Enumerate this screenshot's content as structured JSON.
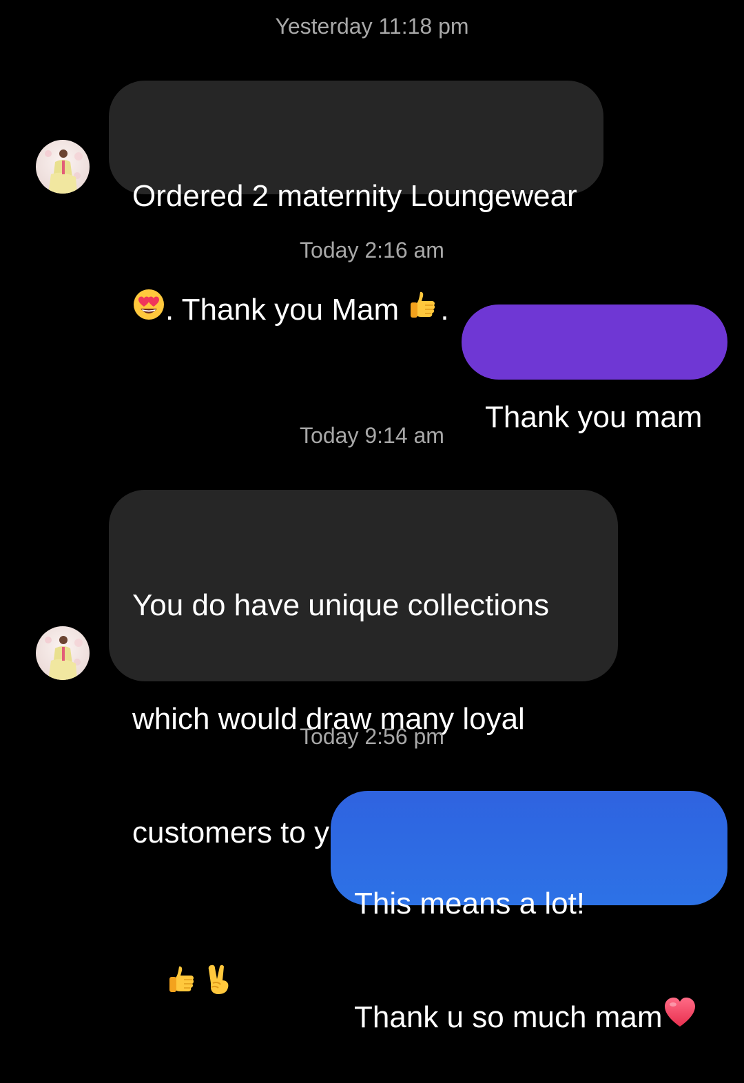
{
  "colors": {
    "background": "#000000",
    "incoming_bubble": "#262626",
    "outgoing_bubble_purple": "#6f37d4",
    "outgoing_bubble_blue_top": "#2f63e0",
    "outgoing_bubble_blue_bottom": "#2d72e6",
    "timestamp_text": "#a8a8a8"
  },
  "thread": [
    {
      "timestamp": "Yesterday 11:18 pm",
      "message": {
        "direction": "incoming",
        "line1": "Ordered 2 maternity Loungewear",
        "line2_text": ". Thank you Mam",
        "line2_end": ".",
        "emojis": [
          "heart-eyes-emoji",
          "thumbs-up-emoji"
        ]
      }
    },
    {
      "timestamp": "Today 2:16 am",
      "message": {
        "direction": "outgoing",
        "text": "Thank you mam"
      }
    },
    {
      "timestamp": "Today 9:14 am",
      "message": {
        "direction": "incoming",
        "lines": [
          "You do have unique collections",
          "which would draw many loyal",
          "customers to you obviously Mam"
        ],
        "emojis": [
          "thumbs-up-emoji",
          "victory-hand-emoji"
        ]
      }
    },
    {
      "timestamp": "Today 2:56 pm",
      "message": {
        "direction": "outgoing",
        "line1": "This means a lot!",
        "line2": "Thank u so much mam",
        "emojis": [
          "red-heart-emoji"
        ]
      }
    }
  ]
}
